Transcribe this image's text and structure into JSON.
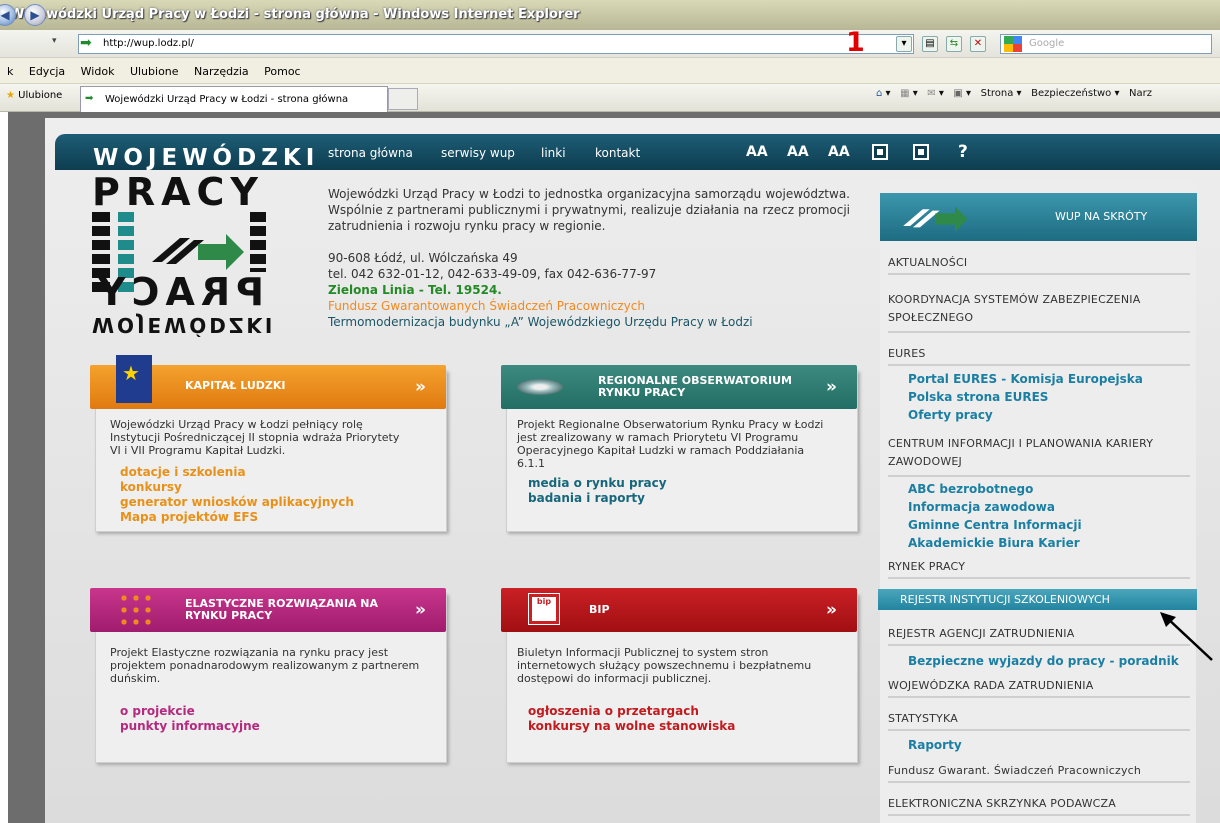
{
  "browser": {
    "title": "Wojewódzki Urząd Pracy w Łodzi - strona główna - Windows Internet Explorer",
    "url": "http://wup.lodz.pl/",
    "annotation": "1",
    "search_placeholder": "Google",
    "menu": [
      "k",
      "Edycja",
      "Widok",
      "Ulubione",
      "Narzędzia",
      "Pomoc"
    ],
    "favorites": "Ulubione",
    "tab_title": "Wojewódzki Urząd Pracy w Łodzi - strona główna",
    "commands": [
      "Strona ▾",
      "Bezpieczeństwo ▾",
      "Narz"
    ]
  },
  "site": {
    "logo": {
      "top": "WOJEWÓDZKI",
      "big": "PRACY",
      "mirror": "PRACY",
      "bottom": "WOJEWÓDZKI"
    },
    "nav": [
      "strona główna",
      "serwisy wup",
      "linki",
      "kontakt"
    ],
    "accessibility": [
      "AA",
      "AA",
      "AA",
      "?"
    ],
    "intro": "Wojewódzki Urząd Pracy w Łodzi to jednostka organizacyjna samorządu województwa. Wspólnie z partnerami publicznymi i prywatnymi, realizuje działania na rzecz promocji zatrudnienia i rozwoju rynku pracy w regionie.",
    "address": "90-608 Łódź, ul. Wólczańska 49",
    "phone": "tel. 042 632-01-12, 042-633-49-09, fax 042-636-77-97",
    "green_line": "Zielona Linia - Tel. 19524.",
    "fund": "Fundusz Gwarantowanych Świadczeń Pracowniczych",
    "thermo": "Termomodernizacja budynku „A” Wojewódzkiego Urzędu Pracy w Łodzi",
    "box1": {
      "title": "KAPITAŁ LUDZKI",
      "text": "Wojewódzki Urząd Pracy w Łodzi pełniący rolę Instytucji Pośredniczącej II stopnia wdraża Priorytety VI i VII Programu Kapitał Ludzki.",
      "links": [
        "dotacje i szkolenia",
        "konkursy",
        "generator wniosków aplikacyjnych",
        "Mapa projektów EFS"
      ]
    },
    "box2": {
      "title": "REGIONALNE OBSERWATORIUM RYNKU PRACY",
      "text": "Projekt Regionalne Obserwatorium Rynku Pracy w Łodzi jest zrealizowany w ramach Priorytetu VI Programu Operacyjnego Kapitał Ludzki w ramach Poddziałania 6.1.1",
      "links": [
        "media o rynku pracy",
        "badania i raporty"
      ]
    },
    "box3": {
      "title": "ELASTYCZNE ROZWIĄZANIA NA RYNKU PRACY",
      "text": "Projekt Elastyczne rozwiązania na rynku pracy jest projektem ponadnarodowym realizowanym z partnerem duńskim.",
      "links": [
        "o projekcie",
        "punkty informacyjne"
      ]
    },
    "box4": {
      "title": "BIP",
      "icon_text": "bip",
      "text": "Biuletyn Informacji Publicznej to system stron internetowych służący powszechnemu i bezpłatnemu dostępowi do informacji publicznej.",
      "links": [
        "ogłoszenia o przetargach",
        "konkursy na wolne stanowiska"
      ]
    },
    "sidebar": {
      "banner": "WUP NA SKRÓTY",
      "aktualnosci": "AKTUALNOŚCI",
      "koordynacja": "KOORDYNACJA SYSTEMÓW ZABEZPIECZENIA SPOŁECZNEGO",
      "eures": "EURES",
      "eures_links": [
        "Portal EURES - Komisja Europejska",
        "Polska strona EURES",
        "Oferty pracy"
      ],
      "centrum": "CENTRUM INFORMACJI I PLANOWANIA KARIERY ZAWODOWEJ",
      "centrum_links": [
        "ABC bezrobotnego",
        "Informacja zawodowa",
        "Gminne Centra Informacji",
        "Akademickie Biura Karier"
      ],
      "rynek": "RYNEK PRACY",
      "rejestr_szkol": "REJESTR INSTYTUCJI SZKOLENIOWYCH",
      "rejestr_agencji": "REJESTR AGENCJI ZATRUDNIENIA",
      "bezpieczne": "Bezpieczne wyjazdy do pracy - poradnik",
      "rada": "WOJEWÓDZKA RADA ZATRUDNIENIA",
      "statystyka": "STATYSTYKA",
      "raporty": "Raporty",
      "fundusz": "Fundusz Gwarant. Świadczeń Pracowniczych",
      "skrzynka": "ELEKTRONICZNA SKRZYNKA PODAWCZA"
    }
  },
  "colors": {
    "teal": "#0e3d50",
    "orange": "#f08a20",
    "pink": "#b52a7d",
    "red": "#c0191b",
    "link_blue": "#1b7fa3"
  }
}
